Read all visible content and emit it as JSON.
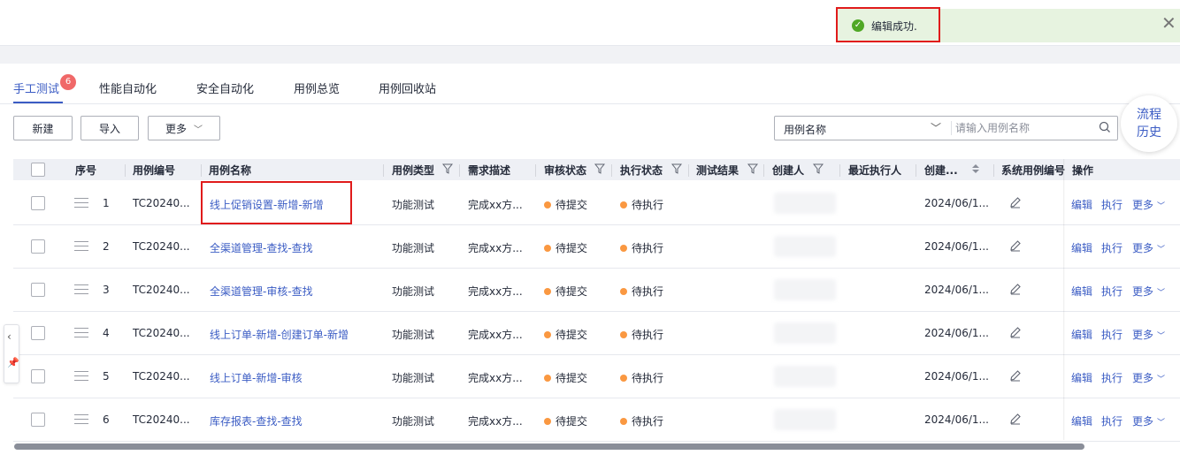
{
  "toast": {
    "message": "编辑成功.",
    "type": "success"
  },
  "tabs": [
    {
      "label": "手工测试",
      "active": true,
      "badge": "6"
    },
    {
      "label": "性能自动化"
    },
    {
      "label": "安全自动化"
    },
    {
      "label": "用例总览"
    },
    {
      "label": "用例回收站"
    }
  ],
  "toolbar": {
    "new_label": "新建",
    "import_label": "导入",
    "more_label": "更多"
  },
  "search": {
    "field": "用例名称",
    "placeholder": "请输入用例名称"
  },
  "flow_history": {
    "line1": "流程",
    "line2": "历史"
  },
  "columns": {
    "index": "序号",
    "code": "用例编号",
    "name": "用例名称",
    "type": "用例类型",
    "desc": "需求描述",
    "review": "审核状态",
    "exec": "执行状态",
    "result": "测试结果",
    "creator": "创建人",
    "last_exec": "最近执行人",
    "created": "创建...",
    "sys_code": "系统用例编号",
    "ops": "操作"
  },
  "rows": [
    {
      "index": "1",
      "code": "TC20240...",
      "name": "线上促销设置-新增-新增",
      "type": "功能测试",
      "desc": "完成xx方...",
      "review": "待提交",
      "exec": "待执行",
      "created": "2024/06/1..."
    },
    {
      "index": "2",
      "code": "TC20240...",
      "name": "全渠道管理-查找-查找",
      "type": "功能测试",
      "desc": "完成xx方...",
      "review": "待提交",
      "exec": "待执行",
      "created": "2024/06/1..."
    },
    {
      "index": "3",
      "code": "TC20240...",
      "name": "全渠道管理-审核-查找",
      "type": "功能测试",
      "desc": "完成xx方...",
      "review": "待提交",
      "exec": "待执行",
      "created": "2024/06/1..."
    },
    {
      "index": "4",
      "code": "TC20240...",
      "name": "线上订单-新增-创建订单-新增",
      "type": "功能测试",
      "desc": "完成xx方...",
      "review": "待提交",
      "exec": "待执行",
      "created": "2024/06/1..."
    },
    {
      "index": "5",
      "code": "TC20240...",
      "name": "线上订单-新增-审核",
      "type": "功能测试",
      "desc": "完成xx方...",
      "review": "待提交",
      "exec": "待执行",
      "created": "2024/06/1..."
    },
    {
      "index": "6",
      "code": "TC20240...",
      "name": "库存报表-查找-查找",
      "type": "功能测试",
      "desc": "完成xx方...",
      "review": "待提交",
      "exec": "待执行",
      "created": "2024/06/1..."
    }
  ],
  "row_actions": {
    "edit": "编辑",
    "run": "执行",
    "more": "更多"
  },
  "colors": {
    "accent": "#3b5cc4",
    "status_dot": "#fa9841",
    "success": "#50a825",
    "highlight": "#e01b1b"
  }
}
